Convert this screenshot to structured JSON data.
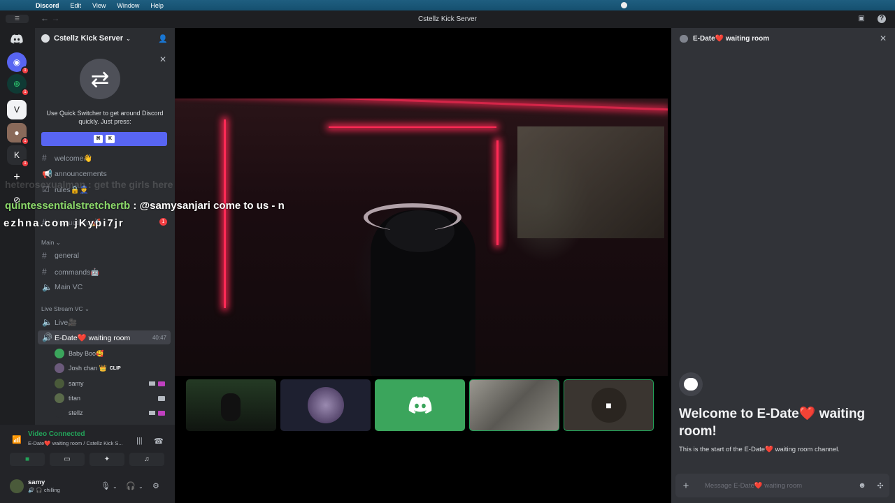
{
  "menubar": {
    "app": "Discord",
    "items": [
      "Edit",
      "View",
      "Window",
      "Help"
    ]
  },
  "titlebar": {
    "title": "Cstellz Kick Server"
  },
  "server": {
    "name": "Cstellz Kick Server"
  },
  "quick_switcher": {
    "text": "Use Quick Switcher to get around Discord quickly. Just press:",
    "keys": [
      "⌘",
      "K"
    ]
  },
  "channels": {
    "welcome": "welcome👋",
    "announcements": "announcements",
    "rules": "rules🔒👮",
    "hidden": "instructions🚀",
    "hidden_badge": "1",
    "category_main": "Main",
    "general": "general",
    "commands": "commands🤖",
    "main_vc": "Main VC",
    "category_live": "Live Stream VC",
    "live": "Live🎥",
    "active_vc": "E-Date❤️ waiting room",
    "active_vc_time": "40:47"
  },
  "voice_users": [
    {
      "name": "Baby Boo🥰",
      "color": "#3ba55c"
    },
    {
      "name": "Josh chan 👑",
      "clip": "CLIP",
      "color": "#6b5a7b"
    },
    {
      "name": "samy",
      "color": "#4a5a3a"
    },
    {
      "name": "titan",
      "color": "#5a6a4a"
    },
    {
      "name": "stellz",
      "color": "#2b2d31"
    }
  ],
  "overlay": {
    "faded": "heterosexualman : get the girls here",
    "user": "quintessentialstretchertb",
    "message": " : @samysanjari come to us - n",
    "line3": "ezhna.com jKypi7jr"
  },
  "voice_panel": {
    "title": "Video Connected",
    "subtitle": "E-Date❤️ waiting room / Cstellz Kick S..."
  },
  "user": {
    "name": "samy",
    "status": "chilling"
  },
  "chat": {
    "header": "E-Date❤️ waiting room",
    "welcome_title": "Welcome to E-Date❤️ waiting room!",
    "welcome_sub": "This is the start of the E-Date❤️ waiting room channel.",
    "placeholder": "Message E-Date❤️ waiting room"
  },
  "colors": {
    "accent": "#5865f2",
    "green": "#23a55a",
    "neon": "#ff2a55"
  }
}
